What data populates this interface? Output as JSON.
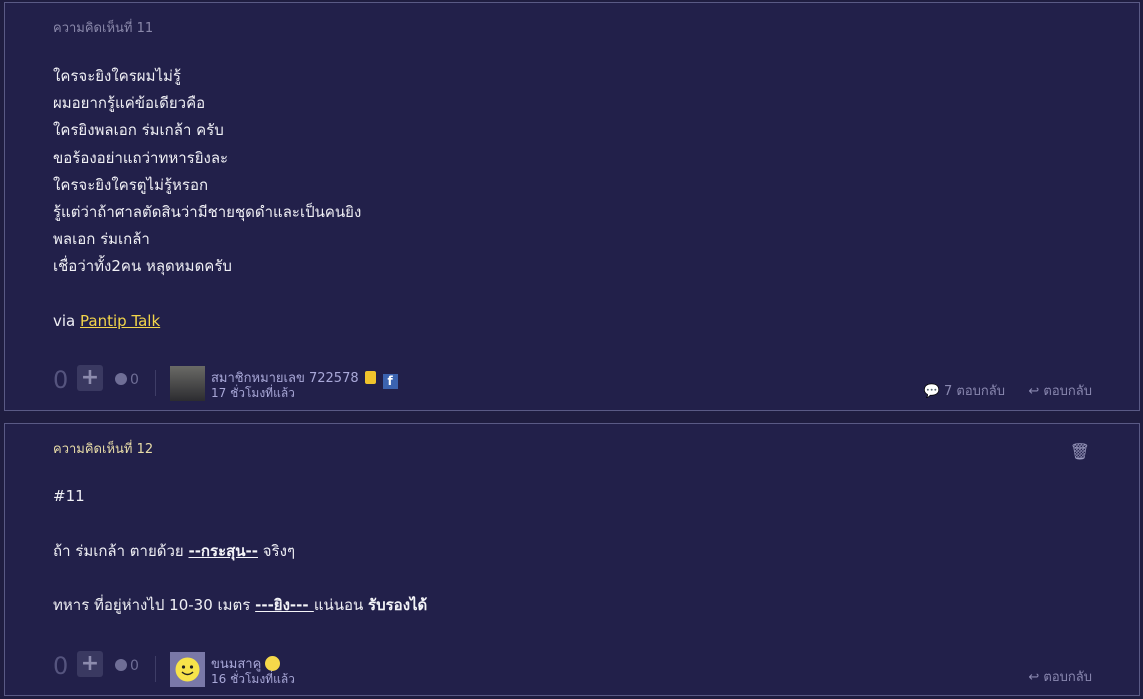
{
  "comments": [
    {
      "header": "ความคิดเห็นที่ 11",
      "lines": [
        "ใครจะยิงใครผมไม่รู้",
        "ผมอยากรู้แค่ข้อเดียวคือ",
        "ใครยิงพลเอก ร่มเกล้า ครับ",
        "ขอร้องอย่าแถว่าทหารยิงละ",
        "ใครจะยิงใครตูไม่รู้หรอก",
        "รู้แต่ว่าถ้าศาลตัดสินว่ามีชายชุดดำและเป็นคนยิง",
        "พลเอก ร่มเกล้า",
        "เชื่อว่าทั้ง2คน หลุดหมดครับ"
      ],
      "via_prefix": "via",
      "via_link": "Pantip Talk",
      "score": "0",
      "emotion_count": "0",
      "username": "สมาชิกหมายเลข 722578",
      "time": "17 ชั่วโมงที่แล้ว",
      "replies_count_label": "7 ตอบกลับ",
      "reply_label": "ตอบกลับ"
    },
    {
      "header": "ความคิดเห็นที่ 12",
      "ref": "#11",
      "line2_a": "ถ้า ร่มเกล้า ตายด้วย ",
      "line2_u": "--กระสุน--",
      "line2_b": " จริงๆ",
      "line3_a": "ทหาร ที่อยู่ห่างไป 10-30 เมตร ",
      "line3_u": "---ยิง--- ",
      "line3_b": "แน่นอน  ",
      "line3_bold": "รับรองได้",
      "score": "0",
      "emotion_count": "0",
      "username": "ขนมสาคู",
      "time": "16 ชั่วโมงที่แล้ว",
      "reply_label": "ตอบกลับ"
    }
  ],
  "icons": {
    "plus": "+",
    "facebook": "f",
    "reply": "↩",
    "trash": "🗑"
  },
  "colors": {
    "background": "#1f1d40",
    "card": "#22204a",
    "link": "#f2d54a",
    "username": "#a9a8d8"
  }
}
